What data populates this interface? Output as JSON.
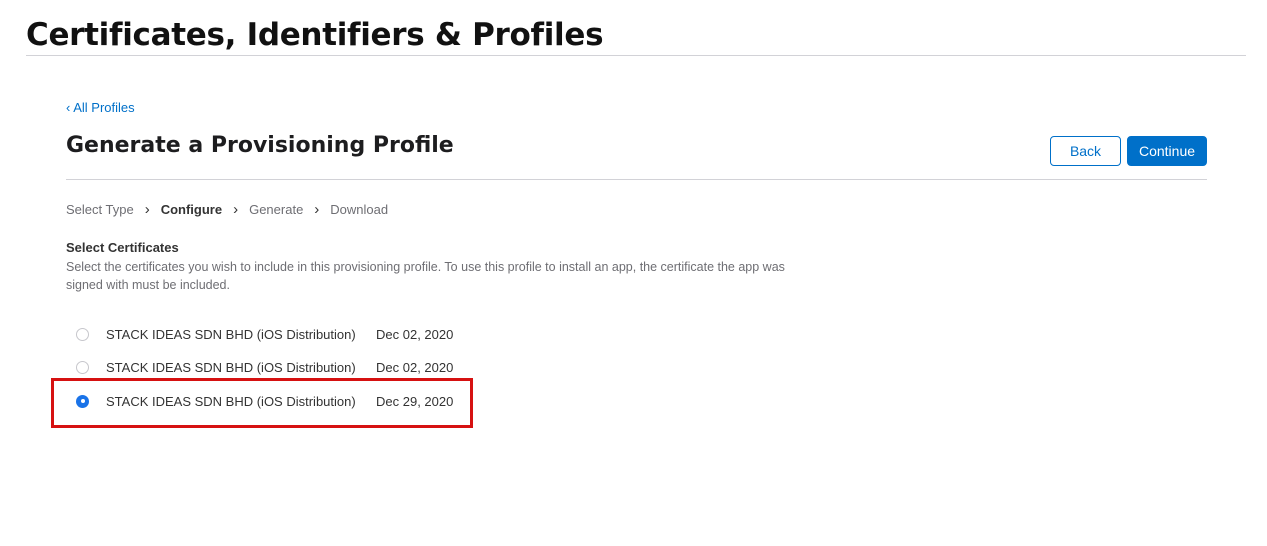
{
  "header": {
    "title": "Certificates, Identifiers & Profiles"
  },
  "page": {
    "back_link": "‹ All Profiles",
    "heading": "Generate a Provisioning Profile",
    "buttons": {
      "back_label": "Back",
      "continue_label": "Continue"
    },
    "steps": [
      "Select Type",
      "Configure",
      "Generate",
      "Download"
    ],
    "current_step": "Configure",
    "section": {
      "title": "Select Certificates",
      "description": "Select the certificates you wish to include in this provisioning profile. To use this profile to install an app, the certificate the app was signed with must be included."
    },
    "certificates": [
      {
        "name": "STACK IDEAS SDN BHD (iOS Distribution)",
        "date": "Dec 02, 2020",
        "selected": false
      },
      {
        "name": "STACK IDEAS SDN BHD (iOS Distribution)",
        "date": "Dec 02, 2020",
        "selected": false
      },
      {
        "name": "STACK IDEAS SDN BHD (iOS Distribution)",
        "date": "Dec 29, 2020",
        "selected": true
      }
    ]
  },
  "colors": {
    "accent": "#0070c9",
    "radio_selected": "#1a73e8",
    "highlight": "#d61111"
  }
}
